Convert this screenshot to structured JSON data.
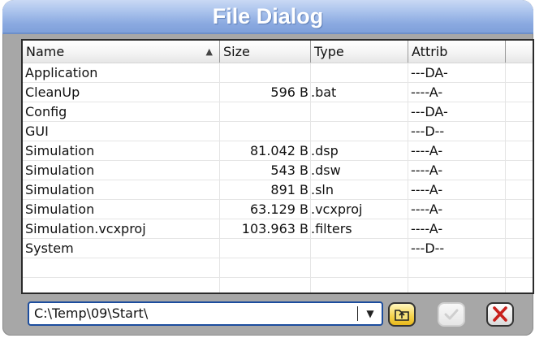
{
  "window": {
    "title": "File Dialog"
  },
  "columns": {
    "name": "Name",
    "size": "Size",
    "type": "Type",
    "attrib": "Attrib"
  },
  "sort": {
    "column": "name",
    "direction": "ascending"
  },
  "files": [
    {
      "name": "Application",
      "size": "",
      "type": "",
      "attrib": "---DA-"
    },
    {
      "name": "CleanUp",
      "size": "596 B",
      "type": ".bat",
      "attrib": "----A-"
    },
    {
      "name": "Config",
      "size": "",
      "type": "",
      "attrib": "---DA-"
    },
    {
      "name": "GUI",
      "size": "",
      "type": "",
      "attrib": "---D--"
    },
    {
      "name": "Simulation",
      "size": "81.042 B",
      "type": ".dsp",
      "attrib": "----A-"
    },
    {
      "name": "Simulation",
      "size": "543 B",
      "type": ".dsw",
      "attrib": "----A-"
    },
    {
      "name": "Simulation",
      "size": "891 B",
      "type": ".sln",
      "attrib": "----A-"
    },
    {
      "name": "Simulation",
      "size": "63.129 B",
      "type": ".vcxproj",
      "attrib": "----A-"
    },
    {
      "name": "Simulation.vcxproj",
      "size": "103.963 B",
      "type": ".filters",
      "attrib": "----A-"
    },
    {
      "name": "System",
      "size": "",
      "type": "",
      "attrib": "---D--"
    },
    {
      "name": "",
      "size": "",
      "type": "",
      "attrib": ""
    },
    {
      "name": "",
      "size": "",
      "type": "",
      "attrib": ""
    }
  ],
  "path": {
    "value": "C:\\Temp\\09\\Start\\"
  },
  "icons": {
    "dropdown": "chevron-down-icon",
    "up": "folder-up-icon",
    "ok": "checkmark-icon",
    "cancel": "close-icon"
  },
  "colors": {
    "title_bar": "#8aa9e0",
    "frame": "#a7a7a7",
    "combo_border": "#1c4d9e",
    "up_button": "#f5d24a",
    "cancel_x": "#c8201c",
    "ok_disabled": "#cfcfcf"
  },
  "buttons": {
    "ok_enabled": false
  }
}
